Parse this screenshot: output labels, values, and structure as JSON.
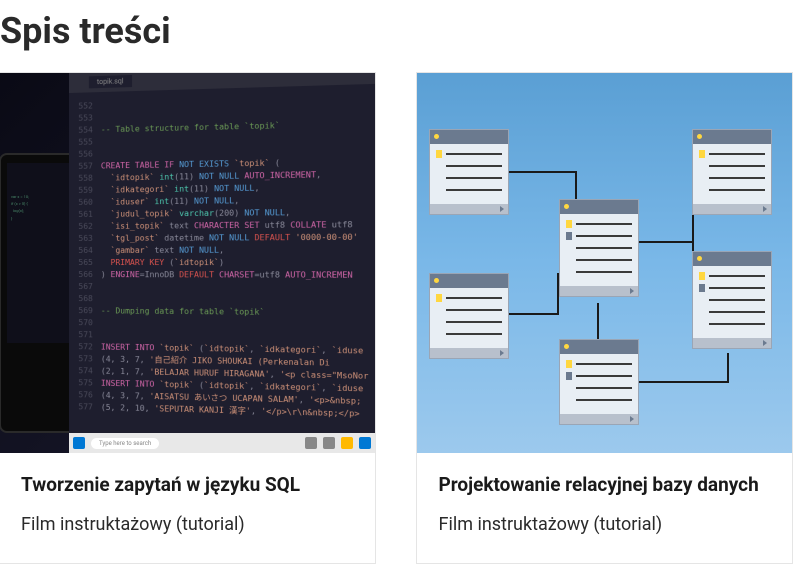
{
  "page_title": "Spis treści",
  "cards": [
    {
      "title": "Tworzenie zapytań w języku SQL",
      "subtitle": "Film instruktażowy (tutorial)"
    },
    {
      "title": "Projektowanie relacyjnej bazy danych",
      "subtitle": "Film instruktażowy (tutorial)"
    }
  ],
  "sql_image": {
    "tab_label": "topik.sql",
    "taskbar_search": "Type here to search",
    "code_lines": [
      {
        "n": "552",
        "t": ""
      },
      {
        "n": "553",
        "t": ""
      },
      {
        "n": "554",
        "t": "-- Table structure for table `topik`",
        "cls": "sql-comment"
      },
      {
        "n": "555",
        "t": ""
      },
      {
        "n": "556",
        "t": ""
      },
      {
        "n": "557",
        "html": "<span class='sql-keyword'>CREATE TABLE IF</span> <span class='sql-keyword2'>NOT EXISTS</span> <span class='sql-string'>`topik`</span> ("
      },
      {
        "n": "558",
        "html": "  <span class='sql-string'>`idtopik`</span> <span class='sql-type'>int</span>(11) <span class='sql-keyword2'>NOT NULL</span> <span class='sql-keyword'>AUTO_INCREMENT</span>,"
      },
      {
        "n": "559",
        "html": "  <span class='sql-string'>`idkategori`</span> <span class='sql-type'>int</span>(11) <span class='sql-keyword2'>NOT NULL</span>,"
      },
      {
        "n": "560",
        "html": "  <span class='sql-string'>`iduser`</span> <span class='sql-type'>int</span>(11) <span class='sql-keyword2'>NOT NULL</span>,"
      },
      {
        "n": "561",
        "html": "  <span class='sql-string'>`judul_topik`</span> <span class='sql-type'>varchar</span>(200) <span class='sql-keyword2'>NOT NULL</span>,"
      },
      {
        "n": "562",
        "html": "  <span class='sql-string'>`isi_topik`</span> text <span class='sql-keyword'>CHARACTER SET</span> utf8 <span class='sql-keyword'>COLLATE</span> utf8"
      },
      {
        "n": "563",
        "html": "  <span class='sql-string'>`tgl_post`</span> datetime <span class='sql-keyword2'>NOT NULL</span> <span class='sql-default'>DEFAULT</span> <span class='sql-string'>'0000-00-00'</span>"
      },
      {
        "n": "564",
        "html": "  <span class='sql-string'>`gambar`</span> text <span class='sql-keyword2'>NOT NULL</span>,"
      },
      {
        "n": "565",
        "html": "  <span class='sql-default'>PRIMARY KEY</span> (<span class='sql-string'>`idtopik`</span>)"
      },
      {
        "n": "566",
        "html": ") <span class='sql-keyword'>ENGINE</span>=InnoDB <span class='sql-default'>DEFAULT</span> <span class='sql-keyword'>CHARSET</span>=utf8 <span class='sql-keyword'>AUTO_INCREMEN</span>"
      },
      {
        "n": "567",
        "t": ""
      },
      {
        "n": "568",
        "t": ""
      },
      {
        "n": "569",
        "t": "-- Dumping data for table `topik`",
        "cls": "sql-comment"
      },
      {
        "n": "570",
        "t": ""
      },
      {
        "n": "571",
        "t": ""
      },
      {
        "n": "572",
        "html": "<span class='sql-keyword'>INSERT INTO</span> <span class='sql-string'>`topik`</span> (<span class='sql-string'>`idtopik`</span>, <span class='sql-string'>`idkategori`</span>, <span class='sql-string'>`iduse</span>"
      },
      {
        "n": "573",
        "html": "(4, 3, 7, <span class='sql-string'>'自己紹介 JIKO SHOUKAI (Perkenalan Di</span>"
      },
      {
        "n": "574",
        "html": "(2, 1, 7, <span class='sql-string'>'BELAJAR HURUF HIRAGANA'</span>, <span class='sql-string'>'&lt;p class=\"MsoNor</span>"
      },
      {
        "n": "575",
        "html": "<span class='sql-keyword'>INSERT INTO</span> <span class='sql-string'>`topik`</span> (<span class='sql-string'>`idtopik`</span>, <span class='sql-string'>`idkategori`</span>, <span class='sql-string'>`iduse</span>"
      },
      {
        "n": "576",
        "html": "(4, 3, 7, <span class='sql-string'>'AISATSU あいさつ UCAPAN SALAM'</span>, <span class='sql-string'>'&lt;p&gt;&amp;nbsp;</span>"
      },
      {
        "n": "577",
        "html": "(5, 2, 10, <span class='sql-string'>'SEPUTAR KANJI 漢字'</span>, <span class='sql-string'>'&lt;/p&gt;\\r\\n&amp;nbsp;&lt;/p&gt;</span>"
      }
    ]
  }
}
